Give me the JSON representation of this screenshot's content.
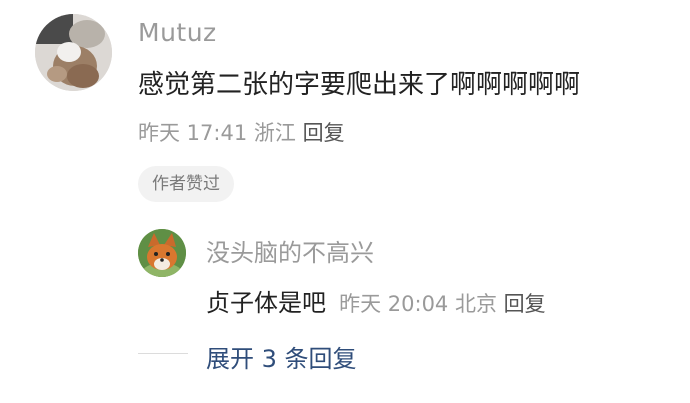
{
  "main_comment": {
    "username": "Mutuz",
    "text": "感觉第二张的字要爬出来了啊啊啊啊啊",
    "time": "昨天 17:41",
    "location": "浙江",
    "reply_label": "回复",
    "author_liked": "作者赞过"
  },
  "reply": {
    "username": "没头脑的不高兴",
    "text": "贞子体是吧",
    "time": "昨天 20:04",
    "location": "北京",
    "reply_label": "回复"
  },
  "expand": {
    "label": "展开 3 条回复"
  }
}
